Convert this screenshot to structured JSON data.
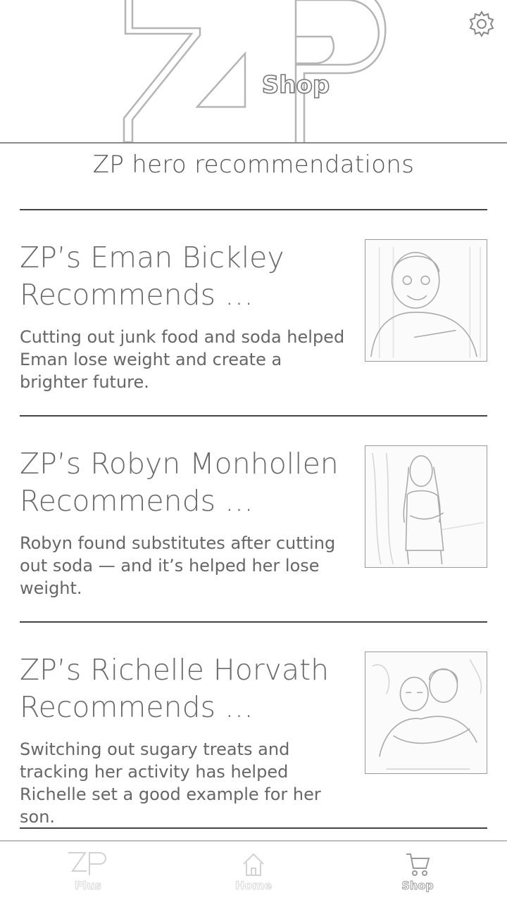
{
  "header": {
    "logo_letters": "ZP",
    "logo_subtitle": "Shop",
    "settings_icon": "gear-icon"
  },
  "section": {
    "title": "ZP hero recommendations"
  },
  "cards": [
    {
      "title_line1": "ZP’s Eman Bickley",
      "title_line2": "Recommends …",
      "description": "Cutting out junk food and soda helped Eman lose weight and create a brighter future."
    },
    {
      "title_line1": "ZP’s Robyn Monhollen",
      "title_line2": "Recommends …",
      "description": "Robyn found substitutes after cutting out soda — and it’s helped her lose weight."
    },
    {
      "title_line1": "ZP’s Richelle Horvath",
      "title_line2": "Recommends …",
      "description": "Switching out sugary treats and tracking her activity has helped Richelle set a good example for her son."
    }
  ],
  "bottom_nav": {
    "items": [
      {
        "label": "Plus",
        "icon": "zp-logo-icon",
        "active": false
      },
      {
        "label": "Home",
        "icon": "home-icon",
        "active": false
      },
      {
        "label": "Shop",
        "icon": "cart-icon",
        "active": true
      }
    ]
  }
}
